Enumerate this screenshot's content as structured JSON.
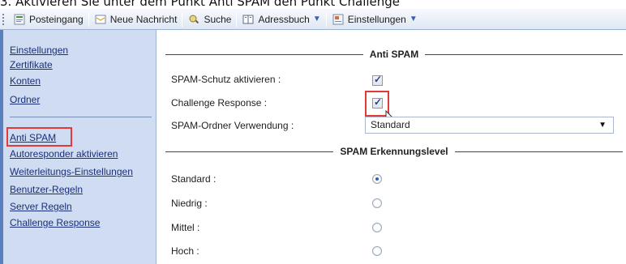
{
  "caption": {
    "text": "3. Aktivieren Sie unter dem Punkt Anti SPAM den Punkt Challenge"
  },
  "toolbar": {
    "inbox": "Posteingang",
    "new_message": "Neue Nachricht",
    "search": "Suche",
    "address_book": "Adressbuch",
    "settings": "Einstellungen"
  },
  "sidebar": {
    "items": [
      {
        "label": "Einstellungen"
      },
      {
        "label": "Zertifikate"
      },
      {
        "label": "Konten"
      },
      {
        "label": "Ordner"
      },
      {
        "label": "Anti SPAM"
      },
      {
        "label": "Autoresponder aktivieren"
      },
      {
        "label": "Weiterleitungs-Einstellungen"
      },
      {
        "label": "Benutzer-Regeln"
      },
      {
        "label": "Server Regeln"
      },
      {
        "label": "Challenge Response"
      }
    ]
  },
  "main": {
    "section_antispam": "Anti SPAM",
    "spam_protection_label": "SPAM-Schutz aktivieren :",
    "spam_protection_checked": true,
    "challenge_label": "Challenge Response :",
    "challenge_checked": true,
    "folder_usage_label": "SPAM-Ordner Verwendung :",
    "folder_usage_value": "Standard",
    "section_level": "SPAM Erkennungslevel",
    "levels": [
      {
        "label": "Standard :",
        "selected": true
      },
      {
        "label": "Niedrig :",
        "selected": false
      },
      {
        "label": "Mittel :",
        "selected": false
      },
      {
        "label": "Hoch :",
        "selected": false
      }
    ]
  },
  "colors": {
    "sidebar_bg": "#cfdcf1",
    "link": "#1a2f7a",
    "highlight": "#e03a3a",
    "radio_selected": "#2b5fb8"
  }
}
